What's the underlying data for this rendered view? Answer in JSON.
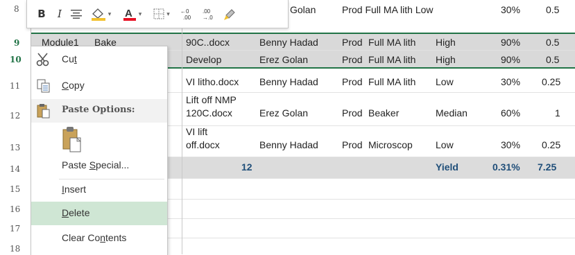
{
  "toolbar": {
    "bold": "B",
    "italic": "I",
    "fill_color": "#f2c12e",
    "font_color": "#e81123"
  },
  "row_numbers": [
    "8",
    "9",
    "10",
    "11",
    "12",
    "13",
    "14",
    "15",
    "16",
    "17",
    "18"
  ],
  "rows": {
    "r8": {
      "c_owner": "Golan",
      "c_type": "Prod Full MA lith Low",
      "c_pct": "30%",
      "c_val": "0.5"
    },
    "r9": {
      "a": "Module1",
      "b": "Bake",
      "file": "90C..docx",
      "owner": "Benny Hadad",
      "type": "Prod",
      "tool": "Full MA lith",
      "level": "High",
      "pct": "90%",
      "val": "0.5"
    },
    "r10": {
      "file": "Develop",
      "owner": "Erez Golan",
      "type": "Prod",
      "tool": "Full MA lith",
      "level": "High",
      "pct": "90%",
      "val": "0.5"
    },
    "r11": {
      "file": "VI litho.docx",
      "owner": "Benny Hadad",
      "type": "Prod",
      "tool": "Full MA lith",
      "level": "Low",
      "pct": "30%",
      "val": "0.25"
    },
    "r12": {
      "file_l1": "Lift off NMP",
      "file_l2": "120C.docx",
      "owner": "Erez Golan",
      "type": "Prod",
      "tool": "Beaker",
      "level": "Median",
      "pct": "60%",
      "val": "1"
    },
    "r13": {
      "file_l1": "VI lift",
      "file_l2": "off.docx",
      "owner": "Benny Hadad",
      "type": "Prod",
      "tool": "Microscop",
      "level": "Low",
      "pct": "30%",
      "val": "0.25"
    },
    "r14": {
      "count": "12",
      "label": "Yield",
      "pct": "0.31%",
      "val": "7.25"
    }
  },
  "context_menu": {
    "cut": {
      "pre": "Cu",
      "key": "t",
      "post": ""
    },
    "copy": {
      "pre": "",
      "key": "C",
      "post": "opy"
    },
    "paste_options": "Paste Options:",
    "paste_special": {
      "pre": "Paste ",
      "key": "S",
      "post": "pecial..."
    },
    "insert": {
      "pre": "",
      "key": "I",
      "post": "nsert"
    },
    "delete": {
      "pre": "",
      "key": "D",
      "post": "elete"
    },
    "clear_contents": {
      "pre": "Clear Co",
      "key": "n",
      "post": "tents"
    }
  },
  "colors": {
    "excel_green": "#217346",
    "hover": "#cfe6d4",
    "selected_row": "#d9d9d9",
    "total_row": "#dcdcdc",
    "total_text": "#1f4e79"
  }
}
